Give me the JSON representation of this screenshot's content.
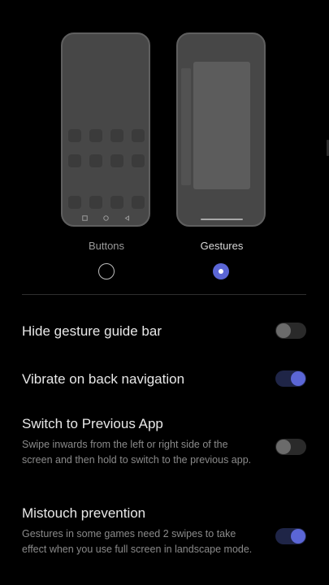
{
  "navigation_modes": {
    "buttons": {
      "label": "Buttons",
      "selected": false
    },
    "gestures": {
      "label": "Gestures",
      "selected": true
    }
  },
  "settings": [
    {
      "title": "Hide gesture guide bar",
      "description": "",
      "enabled": false
    },
    {
      "title": "Vibrate on back navigation",
      "description": "",
      "enabled": true
    },
    {
      "title": "Switch to Previous App",
      "description": "Swipe inwards from the left or right side of the screen and then hold to switch to the previous app.",
      "enabled": false
    },
    {
      "title": "Mistouch prevention",
      "description": "Gestures in some games need 2 swipes to take effect when you use full screen in landscape mode.",
      "enabled": true
    }
  ],
  "colors": {
    "accent": "#5b66d6",
    "background": "#000000",
    "toggle_off_track": "#2a2a2a",
    "toggle_on_track": "#1f2547"
  },
  "icons": {
    "nav_keys": [
      "square-recent-icon",
      "circle-home-icon",
      "triangle-back-icon"
    ]
  }
}
